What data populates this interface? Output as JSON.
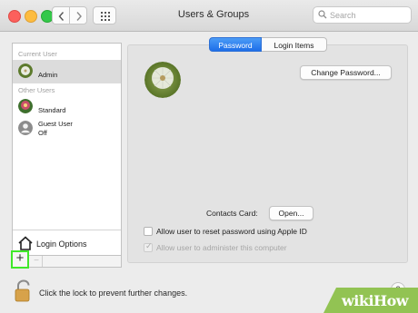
{
  "window": {
    "title": "Users & Groups",
    "search_placeholder": "Search"
  },
  "sidebar": {
    "current_user_header": "Current User",
    "other_users_header": "Other Users",
    "users": [
      {
        "name": "Admin",
        "sub": "",
        "avatar": "dandelion-avatar",
        "selected": true
      },
      {
        "name": "Standard",
        "sub": "",
        "avatar": "flower-avatar",
        "selected": false
      },
      {
        "name": "Guest User",
        "sub": "Off",
        "avatar": "generic-user-avatar",
        "selected": false
      }
    ],
    "login_options": "Login Options",
    "add_label": "+",
    "remove_label": "−"
  },
  "main": {
    "tabs": [
      {
        "label": "Password",
        "active": true
      },
      {
        "label": "Login Items",
        "active": false
      }
    ],
    "change_password_label": "Change Password...",
    "contacts_card_label": "Contacts Card:",
    "open_label": "Open...",
    "reset_password_label": "Allow user to reset password using Apple ID",
    "reset_password_checked": false,
    "administer_label": "Allow user to administer this computer",
    "administer_checked": true,
    "administer_enabled": false
  },
  "footer": {
    "lock_text": "Click the lock to prevent further changes.",
    "help_label": "?"
  },
  "watermark": {
    "wiki": "wiki",
    "how": "How"
  },
  "colors": {
    "tab_active": "#1d6ee9",
    "highlight_box": "#3fe82a",
    "watermark_green": "#92c353"
  }
}
